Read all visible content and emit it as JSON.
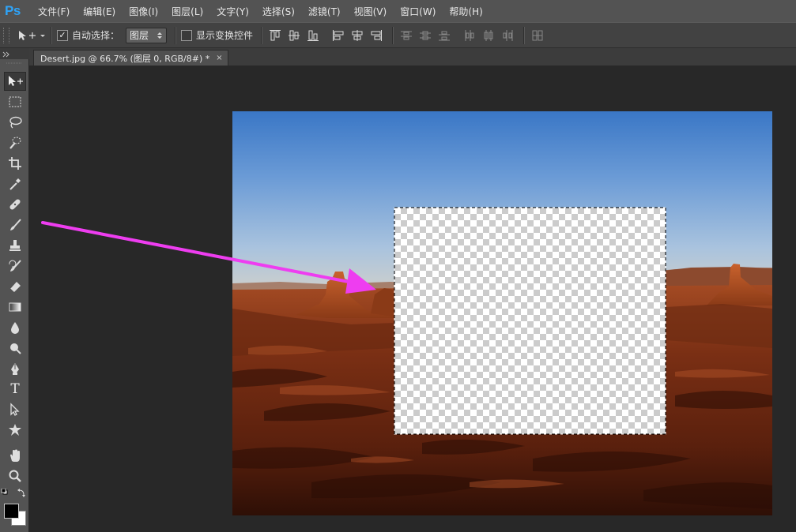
{
  "app": {
    "logo_text": "Ps"
  },
  "menu": [
    {
      "label": "文件(F)"
    },
    {
      "label": "编辑(E)"
    },
    {
      "label": "图像(I)"
    },
    {
      "label": "图层(L)"
    },
    {
      "label": "文字(Y)"
    },
    {
      "label": "选择(S)"
    },
    {
      "label": "滤镜(T)"
    },
    {
      "label": "视图(V)"
    },
    {
      "label": "窗口(W)"
    },
    {
      "label": "帮助(H)"
    }
  ],
  "options": {
    "auto_select_label": "自动选择：",
    "auto_select_checked": true,
    "auto_select_target": "图层",
    "show_transform_label": "显示变换控件",
    "show_transform_checked": false
  },
  "document_tab": {
    "title": "Desert.jpg @ 66.7% (图层 0, RGB/8#) *",
    "close_glyph": "×"
  },
  "toolbar": {
    "tools": [
      "move-tool",
      "marquee-tool",
      "lasso-tool",
      "quick-selection-tool",
      "crop-tool",
      "eyedropper-tool",
      "healing-brush-tool",
      "brush-tool",
      "clone-stamp-tool",
      "history-brush-tool",
      "eraser-tool",
      "gradient-tool",
      "blur-tool",
      "dodge-tool",
      "pen-tool",
      "type-tool",
      "path-selection-tool",
      "custom-shape-tool",
      "hand-tool",
      "zoom-tool"
    ],
    "type_tool_glyph": "T",
    "foreground_color": "#000000",
    "background_color": "#ffffff"
  },
  "colors": {
    "annotation_arrow": "#ee3df0",
    "selection_marquee": "#000000",
    "ps_logo": "#2fa3f7"
  }
}
